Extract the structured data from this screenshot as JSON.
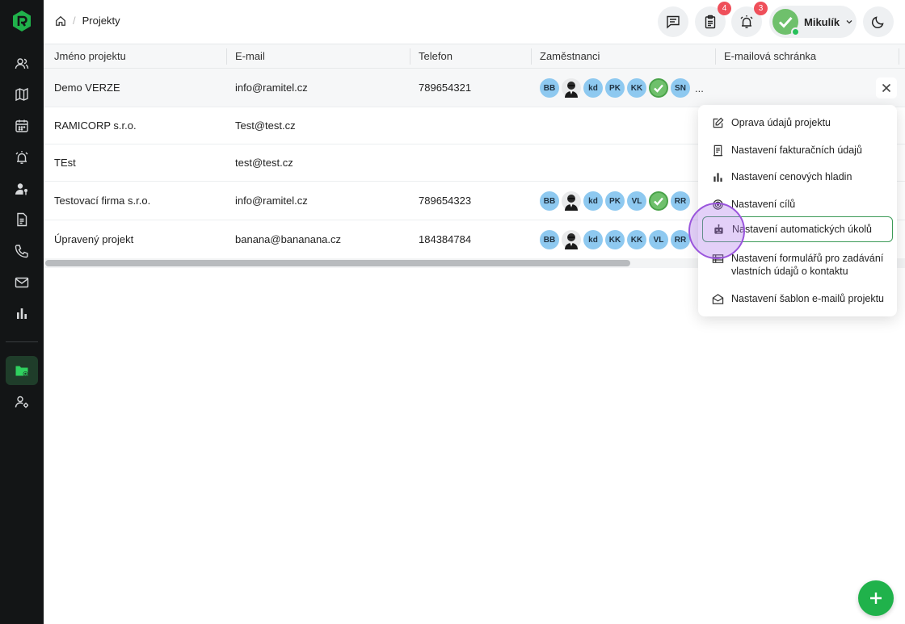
{
  "sidebar": {
    "items": [
      {
        "icon": "users-icon"
      },
      {
        "icon": "map-icon"
      },
      {
        "icon": "calendar-icon"
      },
      {
        "icon": "alarm-icon"
      },
      {
        "icon": "user-key-icon"
      },
      {
        "icon": "document-icon"
      },
      {
        "icon": "phone-icon"
      },
      {
        "icon": "mail-icon"
      },
      {
        "icon": "bar-chart-icon"
      },
      {
        "icon": "folder-settings-icon",
        "active": true
      },
      {
        "icon": "user-settings-icon"
      }
    ]
  },
  "breadcrumb": {
    "current": "Projekty"
  },
  "topbar": {
    "tasks_badge": "4",
    "alerts_badge": "3",
    "user_name": "Mikulík"
  },
  "table": {
    "headers": [
      "Jméno projektu",
      "E-mail",
      "Telefon",
      "Zaměstnanci",
      "E-mailová schránka"
    ],
    "rows": [
      {
        "name": "Demo VERZE",
        "email": "info@ramitel.cz",
        "phone": "789654321",
        "staff": [
          "BB",
          "photo",
          "kd",
          "PK",
          "KK",
          "check",
          "SN"
        ],
        "more": "..."
      },
      {
        "name": "RAMICORP s.r.o.",
        "email": "Test@test.cz",
        "phone": "",
        "staff": []
      },
      {
        "name": "TEst",
        "email": "test@test.cz",
        "phone": "",
        "staff": []
      },
      {
        "name": "Testovací firma s.r.o.",
        "email": "info@ramitel.cz",
        "phone": "789654323",
        "staff": [
          "BB",
          "photo",
          "kd",
          "PK",
          "VL",
          "check",
          "RR"
        ]
      },
      {
        "name": "Úpravený projekt",
        "email": "banana@bananana.cz",
        "phone": "184384784",
        "staff": [
          "BB",
          "photo",
          "kd",
          "KK",
          "KK",
          "VL",
          "RR"
        ]
      }
    ]
  },
  "menu": {
    "items": [
      {
        "label": "Oprava údajů projektu",
        "icon": "edit-icon"
      },
      {
        "label": "Nastavení fakturačních údajů",
        "icon": "invoice-icon"
      },
      {
        "label": "Nastavení cenových hladin",
        "icon": "bar-chart-icon"
      },
      {
        "label": "Nastavení cílů",
        "icon": "target-icon"
      },
      {
        "label": "Nastavení automatických úkolů",
        "icon": "robot-icon",
        "highlighted": true
      },
      {
        "label": "Nastavení formulářů pro zadávání vlastních údajů o kontaktu",
        "icon": "table-icon"
      },
      {
        "label": "Nastavení šablon e-mailů projektu",
        "icon": "envelope-open-icon"
      }
    ]
  },
  "colors": {
    "accent": "#20b24b",
    "sidebar": "#131516",
    "badge": "#ef4f5a",
    "avatar": "#8ec9f0"
  }
}
